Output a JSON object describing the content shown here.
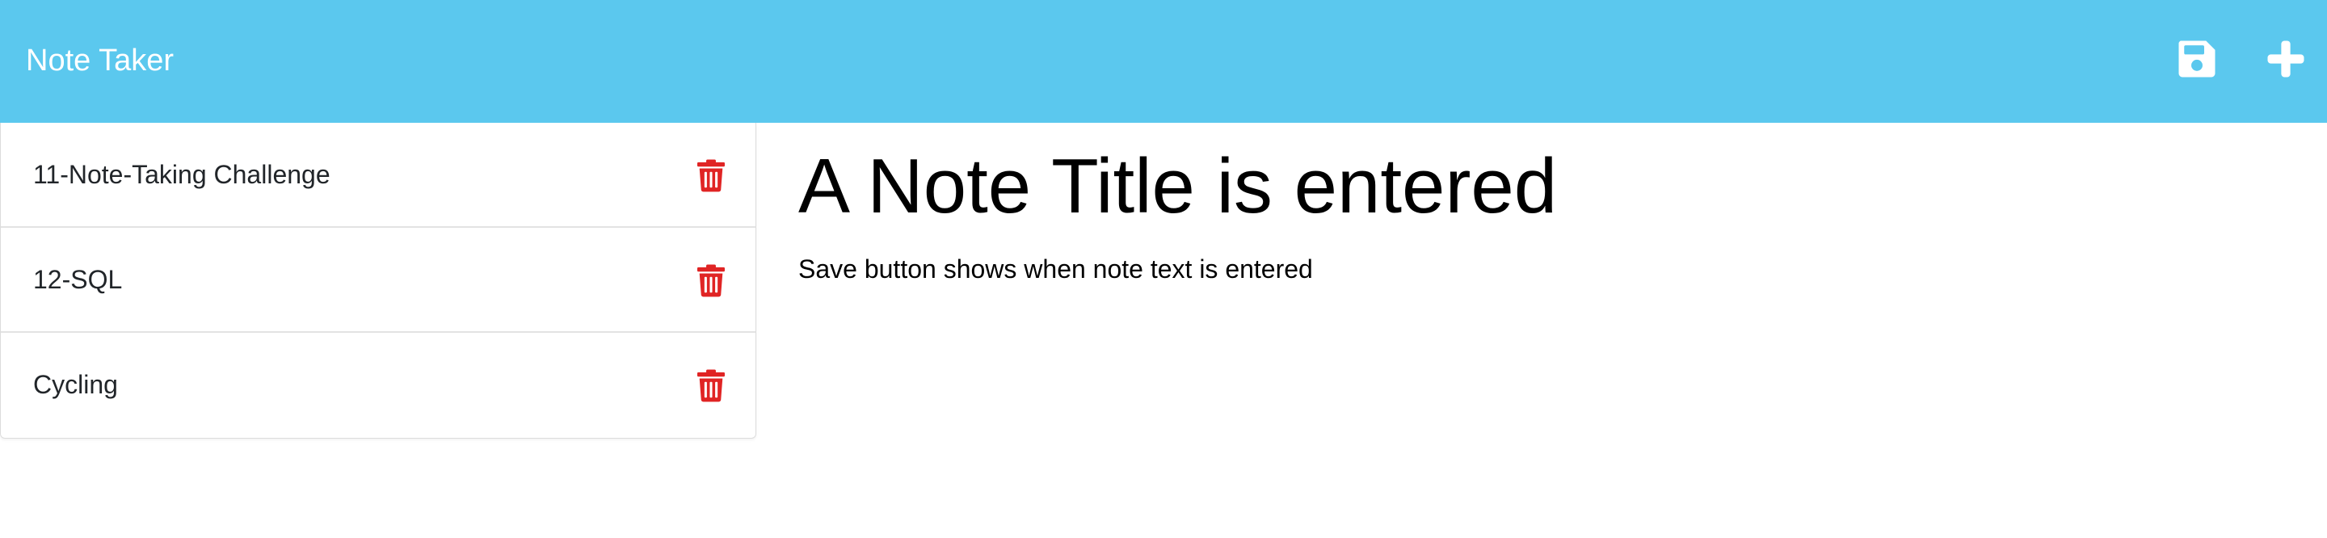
{
  "app": {
    "title": "Note Taker"
  },
  "colors": {
    "navbar": "#5bc8ee",
    "delete": "#e02424",
    "nav_icon": "#ffffff"
  },
  "toolbar": {
    "save_icon": "floppy-disk-icon",
    "new_icon": "plus-icon"
  },
  "notes": [
    {
      "title": "11-Note-Taking Challenge",
      "icon": "trash-icon"
    },
    {
      "title": "12-SQL",
      "icon": "trash-icon"
    },
    {
      "title": "Cycling",
      "icon": "trash-icon"
    }
  ],
  "editor": {
    "title": "A Note Title is entered",
    "text": "Save button shows when note text is entered"
  }
}
